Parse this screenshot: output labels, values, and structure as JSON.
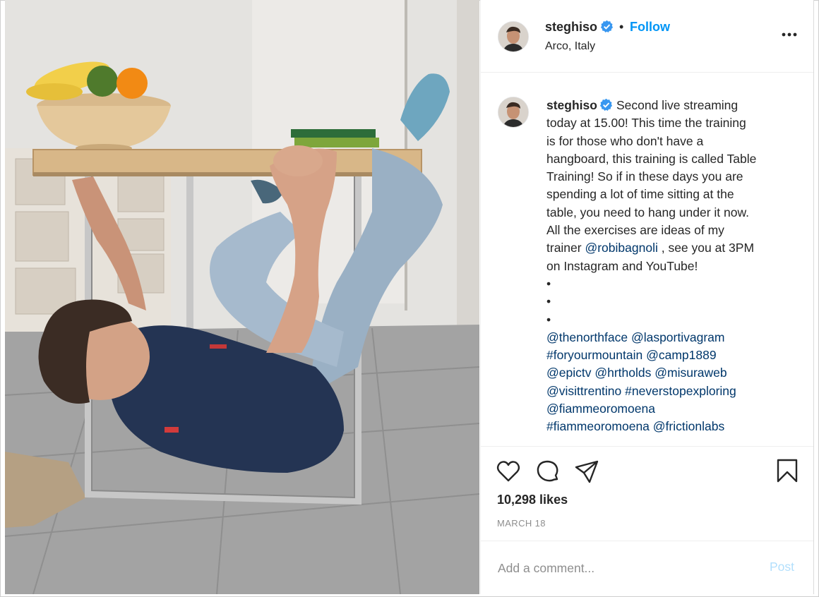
{
  "post": {
    "username": "steghiso",
    "follow_label": "Follow",
    "separator": "•",
    "location": "Arco, Italy",
    "caption_lines": [
      "Second live streaming",
      "today at 15.00! This time the training",
      "is for those who don't have a",
      "hangboard, this training is called Table",
      "Training! So if in these days you are",
      "spending a lot of time sitting at the",
      "table, you need to hang under it now.",
      "All the exercises are ideas of my"
    ],
    "trainer_prefix": "trainer ",
    "trainer_mention": "@robibagnoli",
    "trainer_suffix": " , see you at 3PM",
    "caption_line_last": "on Instagram and YouTube!",
    "bullets": [
      "•",
      "•",
      "•"
    ],
    "tags": [
      [
        "@thenorthface",
        " ",
        "@lasportivagram"
      ],
      [
        "#foryourmountain",
        " ",
        "@camp1889"
      ],
      [
        "@epictv",
        " ",
        "@hrtholds",
        " ",
        "@misuraweb"
      ],
      [
        "@visittrentino",
        " ",
        "#neverstopexploring"
      ],
      [
        "@fiammeoromoena"
      ],
      [
        "#fiammeoromoena",
        " ",
        "@frictionlabs"
      ]
    ],
    "likes_label": "10,298 likes",
    "date_label": "MARCH 18"
  },
  "comment": {
    "placeholder": "Add a comment...",
    "post_label": "Post"
  },
  "icons": {
    "verified": "verified-badge-icon",
    "more": "more-options-icon",
    "like": "heart-icon",
    "comment": "comment-bubble-icon",
    "share": "paper-plane-icon",
    "save": "bookmark-icon"
  },
  "colors": {
    "accent": "#0095f6",
    "link": "#00376b",
    "muted": "#8e8e8e",
    "post_disabled": "#b2dffc"
  }
}
